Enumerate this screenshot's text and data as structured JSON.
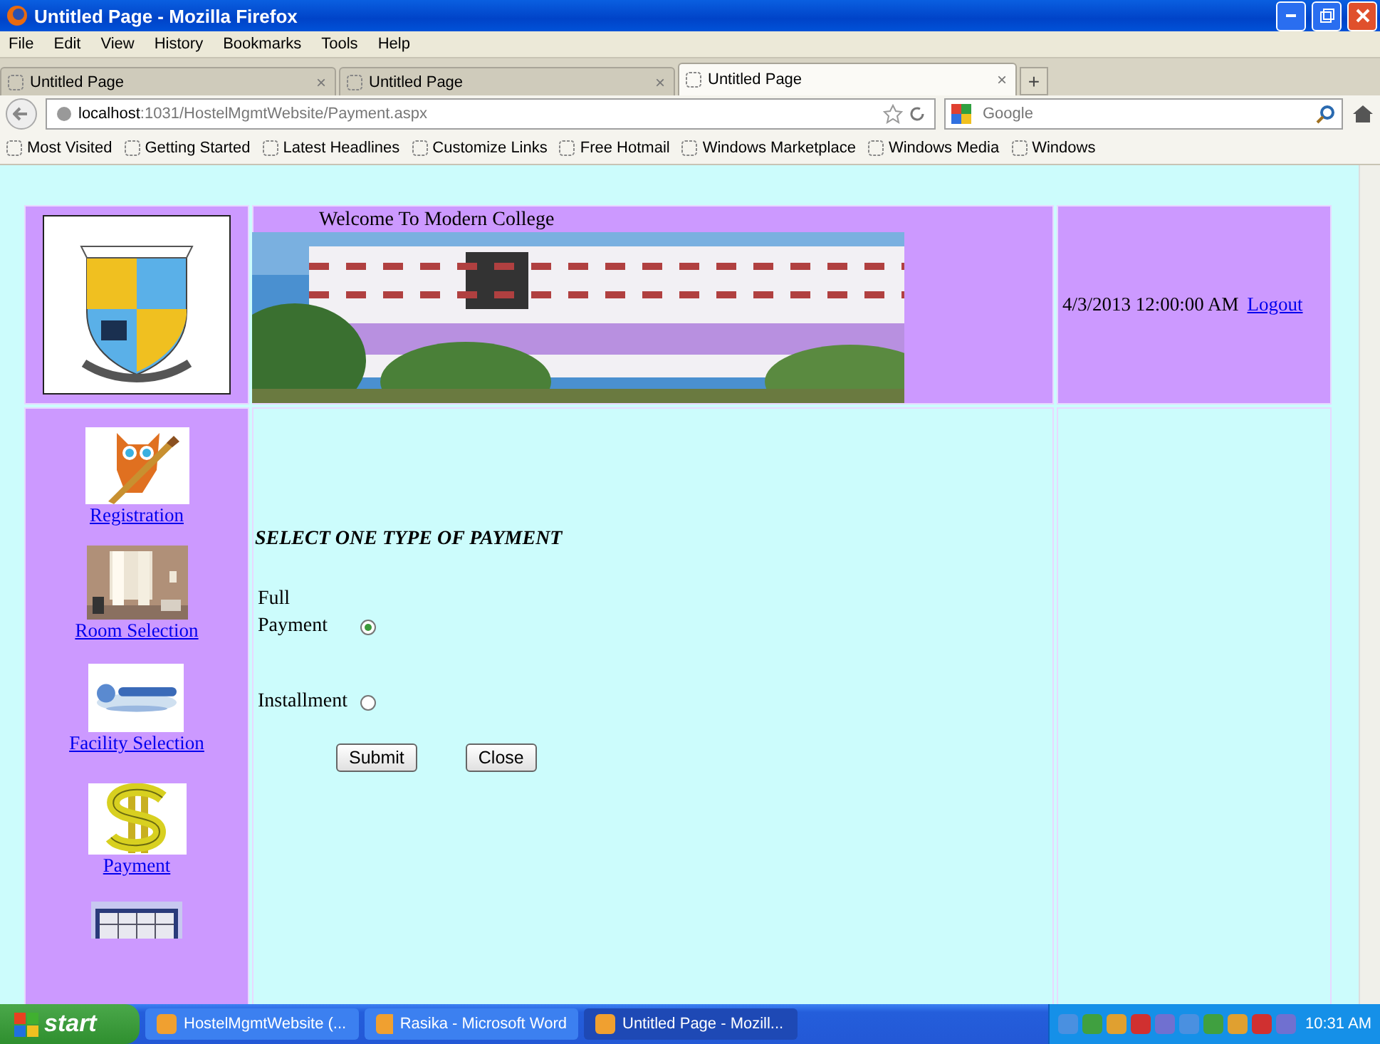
{
  "window": {
    "title": "Untitled Page - Mozilla Firefox"
  },
  "menu": [
    "File",
    "Edit",
    "View",
    "History",
    "Bookmarks",
    "Tools",
    "Help"
  ],
  "tabs": [
    {
      "label": "Untitled Page",
      "close": "×",
      "selected": false
    },
    {
      "label": "Untitled Page",
      "close": "×",
      "selected": false
    },
    {
      "label": "Untitled Page",
      "close": "×",
      "selected": true
    }
  ],
  "new_tab": "+",
  "address": {
    "host": "localhost",
    "path": ":1031/HostelMgmtWebsite/Payment.aspx"
  },
  "search": {
    "placeholder": "Google"
  },
  "bookmarks": [
    "Most Visited",
    "Getting Started",
    "Latest Headlines",
    "Customize Links",
    "Free Hotmail",
    "Windows Marketplace",
    "Windows Media",
    "Windows"
  ],
  "page": {
    "welcome": "Welcome To Modern College",
    "datetime": "4/3/2013 12:00:00 AM",
    "logout": "Logout",
    "nav": [
      {
        "label": "Registration",
        "kind": "owl"
      },
      {
        "label": "Room Selection",
        "kind": "room"
      },
      {
        "label": "Facility Selection",
        "kind": "facility"
      },
      {
        "label": "Payment",
        "kind": "dollar"
      },
      {
        "kind": "calendar"
      }
    ],
    "heading": "SELECT ONE TYPE OF PAYMENT",
    "options": [
      {
        "label": "Full Payment",
        "selected": true
      },
      {
        "label": "Installment",
        "selected": false
      }
    ],
    "buttons": [
      "Submit",
      "Close"
    ]
  },
  "taskbar": {
    "start": "start",
    "items": [
      "HostelMgmtWebsite (...",
      "Rasika - Microsoft Word",
      "Untitled Page - Mozill..."
    ],
    "clock": "10:31 AM"
  }
}
